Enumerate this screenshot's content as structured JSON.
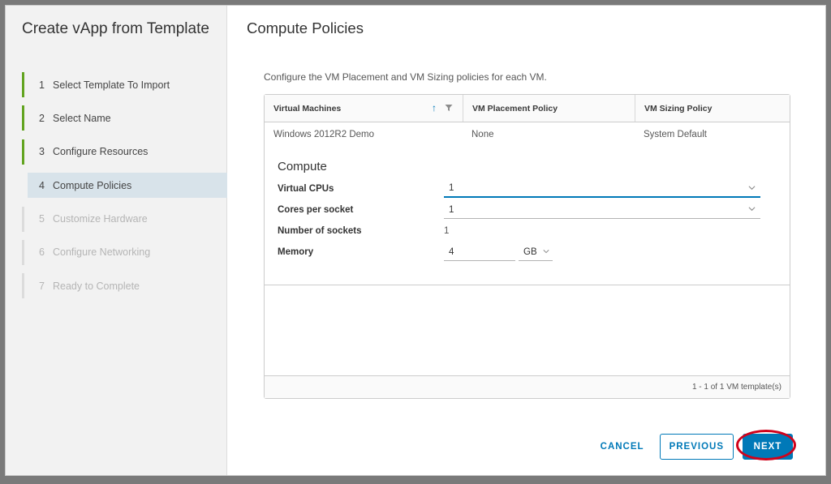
{
  "wizard": {
    "title": "Create vApp from Template",
    "steps": [
      {
        "num": "1",
        "label": "Select Template To Import"
      },
      {
        "num": "2",
        "label": "Select Name"
      },
      {
        "num": "3",
        "label": "Configure Resources"
      },
      {
        "num": "4",
        "label": "Compute Policies"
      },
      {
        "num": "5",
        "label": "Customize Hardware"
      },
      {
        "num": "6",
        "label": "Configure Networking"
      },
      {
        "num": "7",
        "label": "Ready to Complete"
      }
    ]
  },
  "page": {
    "title": "Compute Policies",
    "description": "Configure the VM Placement and VM Sizing policies for each VM."
  },
  "grid": {
    "columns": [
      "Virtual Machines",
      "VM Placement Policy",
      "VM Sizing Policy"
    ],
    "rows": [
      {
        "vm": "Windows 2012R2 Demo",
        "placement": "None",
        "sizing": "System Default"
      }
    ],
    "footer": "1 - 1 of 1 VM template(s)"
  },
  "compute": {
    "title": "Compute",
    "virtual_cpus_label": "Virtual CPUs",
    "virtual_cpus_value": "1",
    "cores_label": "Cores per socket",
    "cores_value": "1",
    "sockets_label": "Number of sockets",
    "sockets_value": "1",
    "memory_label": "Memory",
    "memory_value": "4",
    "memory_unit": "GB"
  },
  "buttons": {
    "cancel": "CANCEL",
    "previous": "PREVIOUS",
    "next": "NEXT"
  },
  "colors": {
    "accent": "#0079b8",
    "completed_step": "#62a420",
    "highlight": "#d0021b"
  },
  "icons": {
    "sort": "sort-ascending-icon",
    "filter": "filter-icon",
    "dropdown": "chevron-down-icon"
  }
}
